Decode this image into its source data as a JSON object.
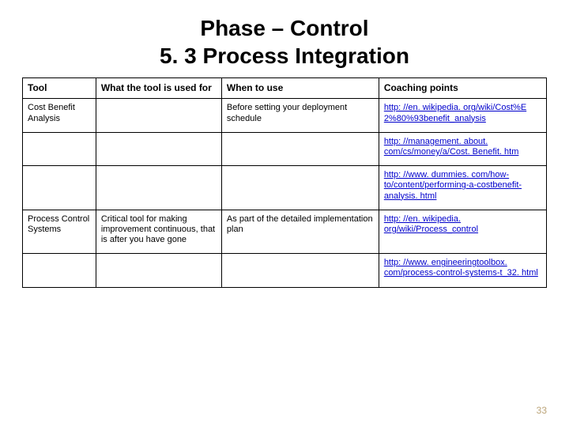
{
  "title_line1": "Phase – Control",
  "title_line2": "5. 3 Process Integration",
  "headers": {
    "c1": "Tool",
    "c2": "What the tool is used for",
    "c3": "When to use",
    "c4": "Coaching points"
  },
  "rows": {
    "r1": {
      "tool": "Cost Benefit Analysis",
      "used_for": "",
      "when": "Before setting your deployment schedule",
      "link": "http: //en. wikipedia. org/wiki/Cost%E 2%80%93benefit_analysis"
    },
    "r2": {
      "tool": "",
      "used_for": "",
      "when": "",
      "link": "http: //management. about. com/cs/money/a/Cost. Benefit. htm"
    },
    "r3": {
      "tool": "",
      "used_for": "",
      "when": "",
      "link": "http: //www. dummies. com/how-to/content/performing-a-costbenefit-analysis. html"
    },
    "r4": {
      "tool": "Process Control Systems",
      "used_for": "Critical tool for making improvement continuous, that is after you have gone",
      "when": "As part of the detailed implementation plan",
      "link": "http: //en. wikipedia. org/wiki/Process_control"
    },
    "r5": {
      "tool": "",
      "used_for": "",
      "when": "",
      "link": "http: //www. engineeringtoolbox. com/process-control-systems-t_32. html"
    }
  },
  "page_number": "33"
}
